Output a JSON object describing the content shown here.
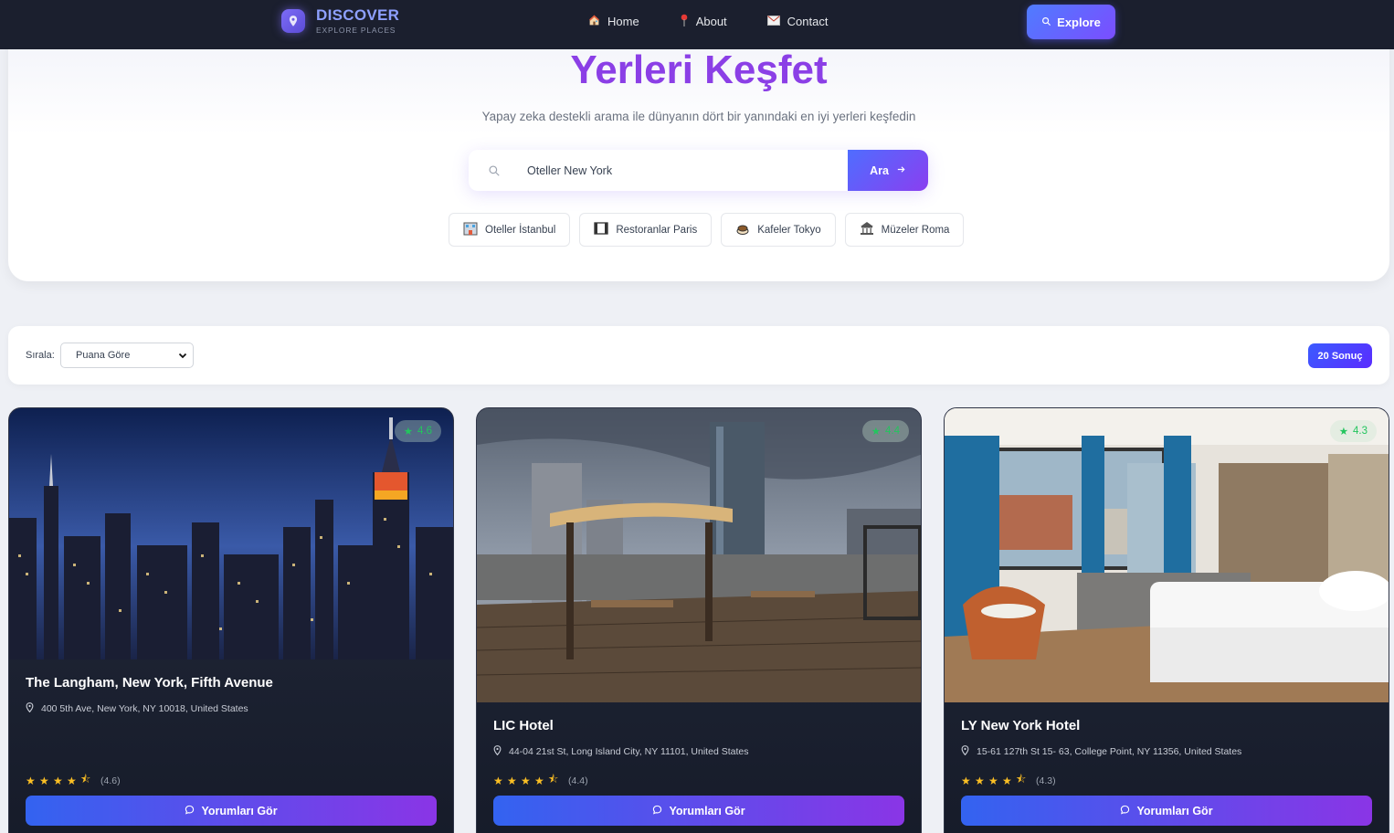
{
  "nav": {
    "brand_title": "DISCOVER",
    "brand_subtitle": "EXPLORE PLACES",
    "links": [
      {
        "label": "Home",
        "icon": "house-icon"
      },
      {
        "label": "About",
        "icon": "pin-icon"
      },
      {
        "label": "Contact",
        "icon": "envelope-icon"
      }
    ],
    "explore_label": "Explore"
  },
  "hero": {
    "title": "Yerleri Keşfet",
    "subtitle": "Yapay zeka destekli arama ile dünyanın dört bir yanındaki en iyi yerleri keşfedin",
    "search_value": "Oteller New York",
    "search_button": "Ara",
    "chips": [
      {
        "label": "Oteller İstanbul",
        "icon": "hotel-icon"
      },
      {
        "label": "Restoranlar Paris",
        "icon": "film-icon"
      },
      {
        "label": "Kafeler Tokyo",
        "icon": "coffee-icon"
      },
      {
        "label": "Müzeler Roma",
        "icon": "museum-icon"
      }
    ]
  },
  "sortbar": {
    "label": "Sırala:",
    "selected": "Puana Göre",
    "result_count": "20 Sonuç"
  },
  "cards": [
    {
      "title": "The Langham, New York, Fifth Avenue",
      "address": "400 5th Ave, New York, NY 10018, United States",
      "rating_badge": "4.6",
      "rating_text": "(4.6)",
      "rating": 4.6,
      "button": "Yorumları Gör"
    },
    {
      "title": "LIC Hotel",
      "address": "44-04 21st St, Long Island City, NY 11101, United States",
      "rating_badge": "4.4",
      "rating_text": "(4.4)",
      "rating": 4.4,
      "button": "Yorumları Gör"
    },
    {
      "title": "LY New York Hotel",
      "address": "15-61 127th St 15- 63, College Point, NY 11356, United States",
      "rating_badge": "4.3",
      "rating_text": "(4.3)",
      "rating": 4.3,
      "button": "Yorumları Gör"
    }
  ],
  "colors": {
    "navbar": "#1b1f2e",
    "accent_purple": "#8b3fe6",
    "accent_blue": "#4f6dff",
    "star": "#fbbf24",
    "rating_green": "#23c55e"
  }
}
